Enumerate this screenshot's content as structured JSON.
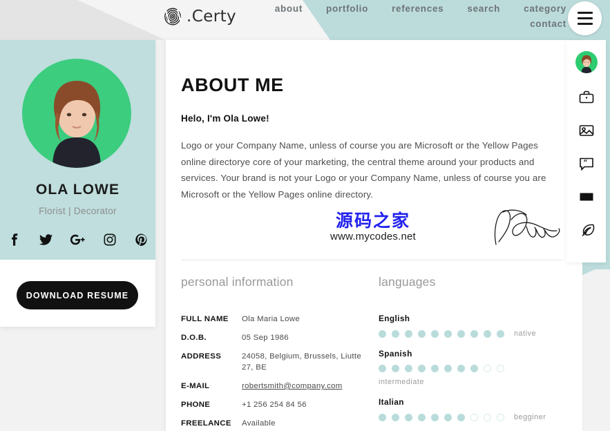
{
  "header": {
    "logo_text": ".Certy",
    "logo_icon": "fingerprint-icon",
    "nav": [
      {
        "label": "about",
        "row": 1
      },
      {
        "label": "portfolio",
        "row": 1
      },
      {
        "label": "references",
        "row": 1
      },
      {
        "label": "search",
        "row": 1
      },
      {
        "label": "category",
        "row": 1
      },
      {
        "label": "contact",
        "row": 2
      }
    ],
    "menu_button": "hamburger-menu"
  },
  "profile": {
    "name": "OLA LOWE",
    "role": "Florist | Decorator",
    "socials": [
      {
        "name": "facebook-icon"
      },
      {
        "name": "twitter-icon"
      },
      {
        "name": "google-plus-icon"
      },
      {
        "name": "instagram-icon"
      },
      {
        "name": "pinterest-icon"
      }
    ],
    "resume_button": "DOWNLOAD RESUME"
  },
  "main": {
    "title": "ABOUT ME",
    "hello": "Helo, I'm Ola Lowe!",
    "body": "Logo or your Company Name, unless of course you are Microsoft or the Yellow Pages online directorye core of your marketing, the central theme around your products and services. Your brand is not your Logo or your Company Name, unless of course you are Microsoft or the Yellow Pages online directory.",
    "watermark_cn": "源码之家",
    "watermark_url": "www.mycodes.net"
  },
  "personal": {
    "heading": "personal information",
    "rows": [
      {
        "label": "FULL NAME",
        "value": "Ola Maria Lowe",
        "link": false
      },
      {
        "label": "D.O.B.",
        "value": "05 Sep 1986",
        "link": false
      },
      {
        "label": "ADDRESS",
        "value": "24058, Belgium, Brussels, Liutte 27, BE",
        "link": false
      },
      {
        "label": "E-MAIL",
        "value": "robertsmith@company.com",
        "link": true
      },
      {
        "label": "PHONE",
        "value": "+1 256 254 84 56",
        "link": false
      },
      {
        "label": "FREELANCE",
        "value": "Available",
        "link": false
      }
    ]
  },
  "languages": {
    "heading": "languages",
    "total_dots": 10,
    "items": [
      {
        "name": "English",
        "filled": 10,
        "level": "native",
        "level_below": false
      },
      {
        "name": "Spanish",
        "filled": 8,
        "level": "intermediate",
        "level_below": true
      },
      {
        "name": "Italian",
        "filled": 7,
        "level": "begginer",
        "level_below": false
      }
    ]
  },
  "rail": {
    "items": [
      {
        "name": "profile-avatar"
      },
      {
        "name": "briefcase-icon"
      },
      {
        "name": "portfolio-image-icon"
      },
      {
        "name": "quote-bubble-icon"
      },
      {
        "name": "envelope-icon"
      },
      {
        "name": "feather-pen-icon"
      }
    ]
  },
  "colors": {
    "teal": "#bcdcdb",
    "teal_card": "#bfdedd",
    "green_avatar": "#3ccd7f",
    "dark": "#111111",
    "page_bg": "#f2f2f2",
    "gray_wedge": "#e4e4e4",
    "watermark_blue": "#2222ee"
  }
}
